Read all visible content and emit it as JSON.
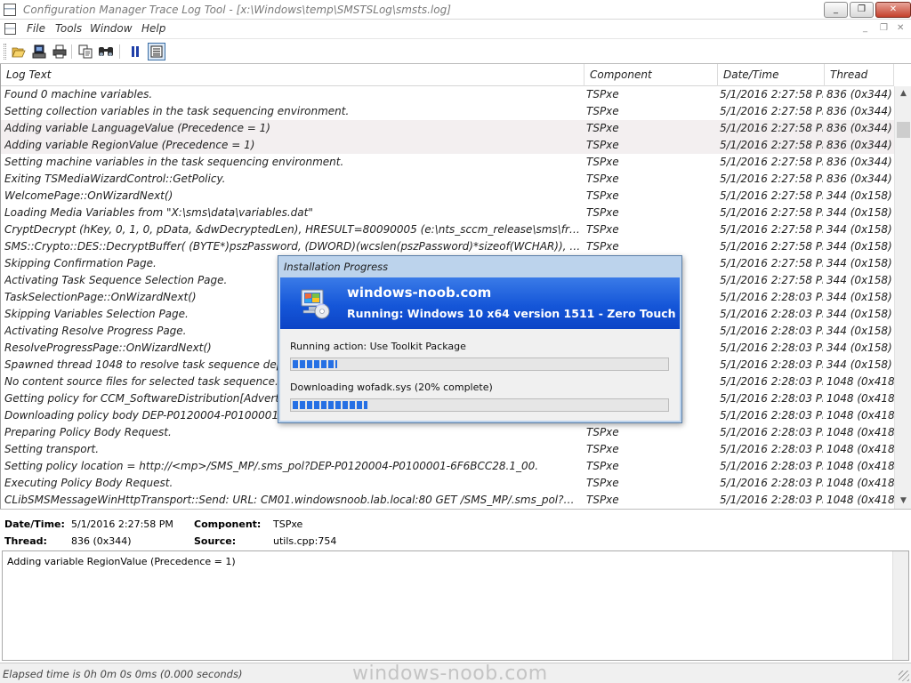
{
  "window": {
    "title": "Configuration Manager Trace Log Tool - [x:\\Windows\\temp\\SMSTSLog\\smsts.log]",
    "controls": {
      "minimize": "_",
      "restore": "❐",
      "close": "✕"
    }
  },
  "menu": {
    "items": [
      "File",
      "Tools",
      "Window",
      "Help"
    ],
    "mdi_controls": {
      "minimize": "_",
      "restore": "❐",
      "close": "✕"
    }
  },
  "toolbar": {
    "buttons": [
      {
        "name": "open-icon"
      },
      {
        "name": "print-preview-icon"
      },
      {
        "name": "print-icon"
      },
      {
        "name": "copy-icon"
      },
      {
        "name": "find-icon"
      },
      {
        "name": "pause-icon"
      },
      {
        "name": "error-lookup-icon"
      }
    ]
  },
  "grid": {
    "columns": [
      "Log Text",
      "Component",
      "Date/Time",
      "Thread"
    ],
    "rows": [
      {
        "text": "Found 0 machine variables.",
        "component": "TSPxe",
        "datetime": "5/1/2016 2:27:58 PM",
        "thread": "836 (0x344)"
      },
      {
        "text": "Setting collection variables in the task sequencing environment.",
        "component": "TSPxe",
        "datetime": "5/1/2016 2:27:58 PM",
        "thread": "836 (0x344)"
      },
      {
        "text": "Adding variable LanguageValue (Precedence = 1)",
        "component": "TSPxe",
        "datetime": "5/1/2016 2:27:58 PM",
        "thread": "836 (0x344)",
        "highlight": true
      },
      {
        "text": "Adding variable RegionValue (Precedence = 1)",
        "component": "TSPxe",
        "datetime": "5/1/2016 2:27:58 PM",
        "thread": "836 (0x344)",
        "highlight": true
      },
      {
        "text": "Setting machine variables in the task sequencing environment.",
        "component": "TSPxe",
        "datetime": "5/1/2016 2:27:58 PM",
        "thread": "836 (0x344)"
      },
      {
        "text": "Exiting TSMediaWizardControl::GetPolicy.",
        "component": "TSPxe",
        "datetime": "5/1/2016 2:27:58 PM",
        "thread": "836 (0x344)"
      },
      {
        "text": "WelcomePage::OnWizardNext()",
        "component": "TSPxe",
        "datetime": "5/1/2016 2:27:58 PM",
        "thread": "344 (0x158)"
      },
      {
        "text": "Loading Media Variables from \"X:\\sms\\data\\variables.dat\"",
        "component": "TSPxe",
        "datetime": "5/1/2016 2:27:58 PM",
        "thread": "344 (0x158)"
      },
      {
        "text": "CryptDecrypt (hKey, 0, 1, 0, pData, &dwDecryptedLen), HRESULT=80090005 (e:\\nts_sccm_release\\sms\\framework\\smscry...",
        "component": "TSPxe",
        "datetime": "5/1/2016 2:27:58 PM",
        "thread": "344 (0x158)"
      },
      {
        "text": "SMS::Crypto::DES::DecryptBuffer( (BYTE*)pszPassword, (DWORD)(wcslen(pszPassword)*sizeof(WCHAR)), encryptedBuffer....",
        "component": "TSPxe",
        "datetime": "5/1/2016 2:27:58 PM",
        "thread": "344 (0x158)"
      },
      {
        "text": "Skipping Confirmation Page.",
        "component": "TSPxe",
        "datetime": "5/1/2016 2:27:58 PM",
        "thread": "344 (0x158)"
      },
      {
        "text": "Activating Task Sequence Selection Page.",
        "component": "TSPxe",
        "datetime": "5/1/2016 2:27:58 PM",
        "thread": "344 (0x158)"
      },
      {
        "text": "TaskSelectionPage::OnWizardNext()",
        "component": "TSPxe",
        "datetime": "5/1/2016 2:28:03 PM",
        "thread": "344 (0x158)"
      },
      {
        "text": "Skipping Variables Selection Page.",
        "component": "TSPxe",
        "datetime": "5/1/2016 2:28:03 PM",
        "thread": "344 (0x158)"
      },
      {
        "text": "Activating Resolve Progress Page.",
        "component": "TSPxe",
        "datetime": "5/1/2016 2:28:03 PM",
        "thread": "344 (0x158)"
      },
      {
        "text": "ResolveProgressPage::OnWizardNext()",
        "component": "TSPxe",
        "datetime": "5/1/2016 2:28:03 PM",
        "thread": "344 (0x158)"
      },
      {
        "text": "Spawned thread 1048 to resolve task sequence dependencies",
        "component": "TSPxe",
        "datetime": "5/1/2016 2:28:03 PM",
        "thread": "344 (0x158)"
      },
      {
        "text": "No content source files for selected task sequence.",
        "component": "TSPxe",
        "datetime": "5/1/2016 2:28:03 PM",
        "thread": "1048 (0x418)"
      },
      {
        "text": "Getting policy for CCM_SoftwareDistribution[AdvertID=\"P0",
        "component": "TSPxe",
        "datetime": "5/1/2016 2:28:03 PM",
        "thread": "1048 (0x418)"
      },
      {
        "text": "Downloading policy body DEP-P0120004-P0100001-6F6BC",
        "component": "TSPxe",
        "datetime": "5/1/2016 2:28:03 PM",
        "thread": "1048 (0x418)"
      },
      {
        "text": "Preparing Policy Body Request.",
        "component": "TSPxe",
        "datetime": "5/1/2016 2:28:03 PM",
        "thread": "1048 (0x418)"
      },
      {
        "text": "   Setting transport.",
        "component": "TSPxe",
        "datetime": "5/1/2016 2:28:03 PM",
        "thread": "1048 (0x418)"
      },
      {
        "text": "   Setting policy location = http://<mp>/SMS_MP/.sms_pol?DEP-P0120004-P0100001-6F6BCC28.1_00.",
        "component": "TSPxe",
        "datetime": "5/1/2016 2:28:03 PM",
        "thread": "1048 (0x418)"
      },
      {
        "text": "Executing Policy Body Request.",
        "component": "TSPxe",
        "datetime": "5/1/2016 2:28:03 PM",
        "thread": "1048 (0x418)"
      },
      {
        "text": "CLibSMSMessageWinHttpTransport::Send: URL: CM01.windowsnoob.lab.local:80  GET /SMS_MP/.sms_pol?DEP-P0120004-...",
        "component": "TSPxe",
        "datetime": "5/1/2016 2:28:03 PM",
        "thread": "1048 (0x418)"
      }
    ]
  },
  "details": {
    "datetime_label": "Date/Time:",
    "datetime_value": "5/1/2016 2:27:58 PM",
    "component_label": "Component:",
    "component_value": "TSPxe",
    "thread_label": "Thread:",
    "thread_value": "836 (0x344)",
    "source_label": "Source:",
    "source_value": "utils.cpp:754",
    "message": "Adding variable RegionValue (Precedence = 1)"
  },
  "status": {
    "text": "Elapsed time is 0h 0m 0s 0ms (0.000 seconds)",
    "watermark": "windows-noob.com"
  },
  "dialog": {
    "title": "Installation Progress",
    "organization": "windows-noob.com",
    "sequence": "Running: Windows 10 x64 version 1511 - Zero Touch",
    "action_text": "Running action: Use Toolkit Package",
    "action_progress": 0.12,
    "download_text": "Downloading wofadk.sys (20% complete)",
    "download_progress": 0.2
  }
}
